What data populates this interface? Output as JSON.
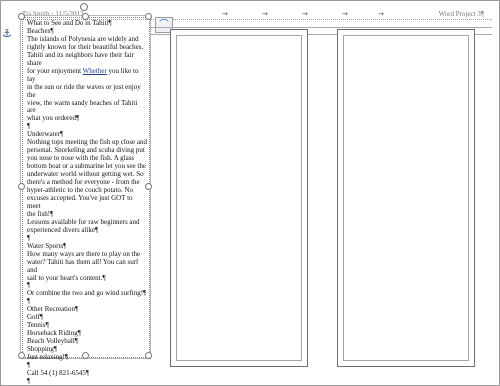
{
  "header": {
    "left": "Tia Smith · 11/5/2012",
    "right": "Word Project 3¶",
    "tab_arrow": "→"
  },
  "icons": {
    "anchor": "⚓",
    "layout_options": "⌒"
  },
  "textbox": {
    "lines": [
      "What to See and Do in Tahiti¶",
      "Beaches¶",
      "The islands of Polynesia are widely and",
      "rightly known for their beautiful beaches.",
      "Tahiti and its neighbors have their fair share",
      "for your enjoyment Whether you like to lay",
      "in the sun or ride the waves or just enjoy the",
      "view, the warm sandy beaches of Tahiti are",
      "what you ordered¶",
      "¶",
      "Underwater¶",
      "Nothing tops meeting the fish up close and",
      "personal. Snorkeling and scuba diving put",
      "you nose to nose with the fish. A glass",
      "bottom boat or a submarine let you see the",
      "underwater world without getting wet. So",
      "there's a method for everyone - from the",
      "hyper-athletic to the couch potato. No",
      "excuses accepted. You've just GOT to meet",
      "the fish!¶",
      "Lessons available for raw beginners and",
      "experienced divers alike¶",
      "¶",
      "Water Sports¶",
      "How many ways are there to play on the",
      "water? Tahiti has them all! You can surf and",
      "sail to your heart's content.¶",
      "¶",
      "Or combine the two and go wind surfing!¶",
      "¶",
      "Other Recreation¶",
      "Golf¶",
      "Tennis¶",
      "Horseback Riding¶",
      "Beach Volleyball¶",
      "Shopping¶",
      "Just relaxing!¶",
      "¶",
      "Call 54 (1) 821-6545¶",
      "¶"
    ],
    "link_word": "Whether"
  }
}
